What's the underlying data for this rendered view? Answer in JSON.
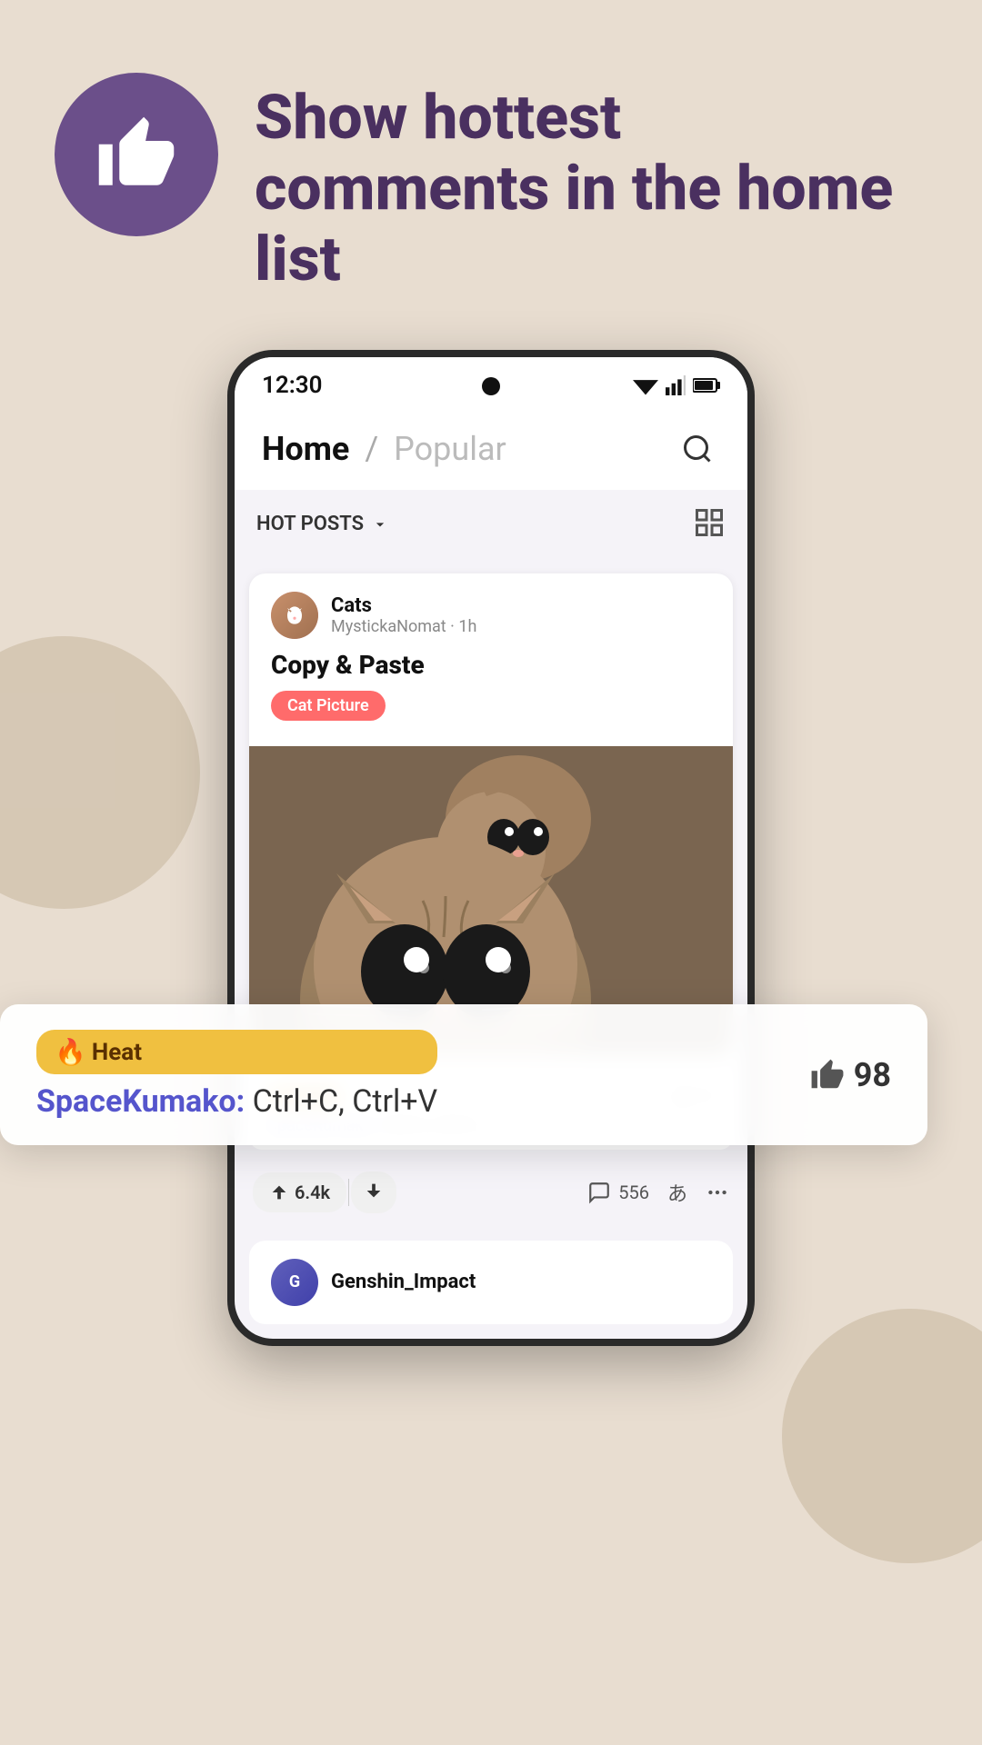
{
  "background": {
    "color": "#e8ddd0"
  },
  "header": {
    "title": "Show hottest comments in the home list",
    "thumb_icon": "thumbs-up"
  },
  "phone": {
    "status_bar": {
      "time": "12:30",
      "signal": "wifi-signal",
      "battery": "battery"
    },
    "nav": {
      "primary": "Home",
      "separator": "/",
      "secondary": "Popular",
      "search_icon": "search"
    },
    "filter": {
      "label": "HOT POSTS",
      "dropdown_icon": "chevron-down",
      "layout_icon": "layout"
    },
    "post": {
      "community": "Cats",
      "user": "MystickaNomat",
      "time": "1h",
      "title": "Copy & Paste",
      "tag": "Cat Picture"
    },
    "comment_in_card": {
      "heat_label": "Heat",
      "username": "SpaceKumako:",
      "text": "Ctrl+C, Ctrl+V",
      "likes": "98"
    },
    "post_actions": {
      "upvote": "6.4k",
      "comments": "556",
      "font_icon": "あ",
      "more_icon": "more"
    },
    "next_post": {
      "community": "Genshin_Impact"
    }
  },
  "floating_comment": {
    "heat_label": "Heat",
    "fire_emoji": "🔥",
    "username": "SpaceKumako:",
    "comment_text": "Ctrl+C, Ctrl+V",
    "likes": "98"
  },
  "colors": {
    "purple_dark": "#4a3060",
    "purple_badge": "#6b4f8a",
    "tag_red": "#ff6b6b",
    "heat_gold": "#f0c040",
    "link_blue": "#5555cc",
    "text_dark": "#111111",
    "text_muted": "#888888"
  }
}
